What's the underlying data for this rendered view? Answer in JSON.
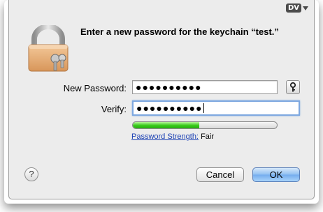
{
  "dialog": {
    "badge": "DV",
    "title": "Enter a new password for the keychain “test.”",
    "new_password": {
      "label": "New Password:",
      "value": "●●●●●●●●●●"
    },
    "verify": {
      "label": "Verify:",
      "value": "●●●●●●●●●●"
    },
    "strength": {
      "link": "Password Strength:",
      "value": "Fair",
      "level_percent": 46,
      "bar_color": "#35c919"
    },
    "help_label": "?",
    "buttons": {
      "cancel": "Cancel",
      "ok": "OK"
    },
    "icons": {
      "lock": "padlock-with-keys-icon",
      "key": "key-icon",
      "help": "help-icon"
    }
  }
}
